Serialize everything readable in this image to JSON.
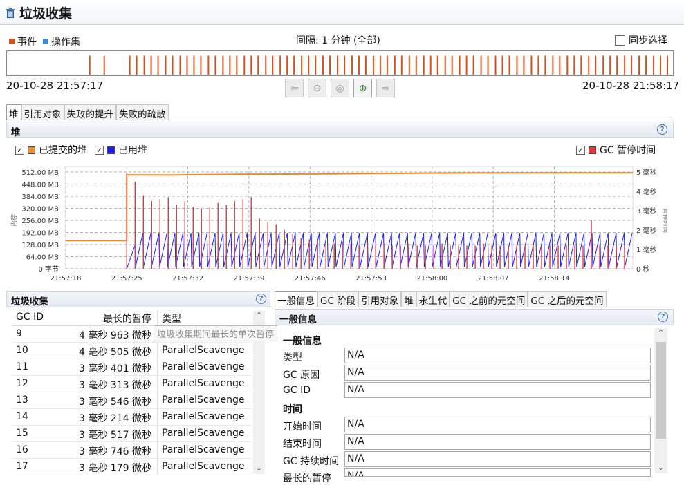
{
  "window": {
    "title": "垃圾收集"
  },
  "legend": {
    "events_label": "事件",
    "opsets_label": "操作集",
    "events_color": "#d94f1a",
    "opsets_color": "#3a8ad4"
  },
  "interval": "间隔: 1 分钟 (全部)",
  "sync_select": {
    "label": "同步选择",
    "checked": false
  },
  "timeline": {
    "start": "20-10-28 21:57:17",
    "end": "20-10-28 21:58:17"
  },
  "tabs": [
    "堆",
    "引用对象",
    "失败的提升",
    "失败的疏散"
  ],
  "heap_panel": {
    "title": "堆",
    "committed_label": "已提交的堆",
    "used_label": "已用堆",
    "gc_pause_label": "GC 暂停时间",
    "committed_color": "#f08a24",
    "used_color": "#1c1cff",
    "pause_color": "#e8343a"
  },
  "chart_data": {
    "type": "line",
    "ylabel": "内存",
    "y2label": "暂停时间",
    "yticks": [
      "512.00 MB",
      "448.00 MB",
      "384.00 MB",
      "320.00 MB",
      "256.00 MB",
      "192.00 MB",
      "128.00 MB",
      "64.00 MB",
      "0 字节"
    ],
    "y2ticks": [
      "5 毫秒",
      "4 毫秒",
      "3 毫秒",
      "2 毫秒",
      "1 毫秒",
      "0 秒"
    ],
    "xticks": [
      "21:57:18",
      "21:57:25",
      "21:57:32",
      "21:57:39",
      "21:57:46",
      "21:57:53",
      "21:58:00",
      "21:58:07",
      "21:58:14"
    ],
    "ylim_mb": [
      0,
      512
    ],
    "y2lim_ms": [
      0,
      5
    ],
    "series": [
      {
        "name": "已提交的堆",
        "points": [
          [
            0,
            149
          ],
          [
            7,
            149
          ],
          [
            7,
            497
          ],
          [
            12,
            496
          ],
          [
            20,
            500
          ],
          [
            30,
            502
          ],
          [
            45,
            507
          ],
          [
            65,
            508
          ]
        ]
      },
      {
        "name": "已用堆",
        "sawtooth": {
          "start": 7,
          "end": 65,
          "count": 62,
          "peak_mb": 190,
          "low_mb": 10
        }
      },
      {
        "name": "GC 暂停时间",
        "pauses_ms": [
          4.96,
          4.5,
          3.8,
          3.5,
          3.6,
          3.7,
          3.3,
          3.5,
          3.2,
          3.1,
          3.2,
          3.4,
          3.3,
          3.5,
          3.6,
          3.7,
          2.6,
          2.4,
          2.3,
          2.0,
          1.8,
          1.6,
          1.5,
          1.4,
          1.3,
          1.3,
          1.4,
          1.3,
          1.2,
          1.3,
          1.2,
          1.3,
          1.2,
          1.2,
          1.3,
          1.2,
          1.2,
          1.2,
          1.3,
          1.2,
          1.2,
          1.2,
          1.2,
          1.3,
          1.2,
          1.2,
          1.2,
          1.2,
          1.2,
          1.2,
          1.2,
          1.2,
          1.2,
          1.2,
          1.2,
          1.2,
          2.5,
          1.2,
          1.2,
          1.2,
          1.2
        ]
      }
    ]
  },
  "gc_panel": {
    "title": "垃圾收集",
    "headers": [
      "GC ID",
      "最长的暂停",
      "类型"
    ],
    "tooltip": "垃圾收集期间最长的单次暂停",
    "rows": [
      {
        "id": "9",
        "pause": "4 毫秒 963 微秒",
        "type": "ParallelScavenge"
      },
      {
        "id": "10",
        "pause": "4 毫秒 505 微秒",
        "type": "ParallelScavenge"
      },
      {
        "id": "11",
        "pause": "3 毫秒 401 微秒",
        "type": "ParallelScavenge"
      },
      {
        "id": "12",
        "pause": "3 毫秒 313 微秒",
        "type": "ParallelScavenge"
      },
      {
        "id": "13",
        "pause": "3 毫秒 546 微秒",
        "type": "ParallelScavenge"
      },
      {
        "id": "14",
        "pause": "3 毫秒 214 微秒",
        "type": "ParallelScavenge"
      },
      {
        "id": "15",
        "pause": "3 毫秒 517 微秒",
        "type": "ParallelScavenge"
      },
      {
        "id": "16",
        "pause": "3 毫秒 746 微秒",
        "type": "ParallelScavenge"
      },
      {
        "id": "17",
        "pause": "3 毫秒 179 微秒",
        "type": "ParallelScavenge"
      }
    ]
  },
  "detail_tabs": [
    "一般信息",
    "GC 阶段",
    "引用对象",
    "堆",
    "永生代",
    "GC 之前的元空间",
    "GC 之后的元空间"
  ],
  "detail": {
    "title": "一般信息",
    "section_general": "一般信息",
    "fields_general": [
      {
        "label": "类型",
        "value": "N/A"
      },
      {
        "label": "GC 原因",
        "value": "N/A"
      },
      {
        "label": "GC ID",
        "value": "N/A"
      }
    ],
    "section_time": "时间",
    "fields_time": [
      {
        "label": "开始时间",
        "value": "N/A"
      },
      {
        "label": "结束时间",
        "value": "N/A"
      },
      {
        "label": "GC 持续时间",
        "value": "N/A"
      },
      {
        "label": "最长的暂停",
        "value": "N/A"
      }
    ]
  }
}
